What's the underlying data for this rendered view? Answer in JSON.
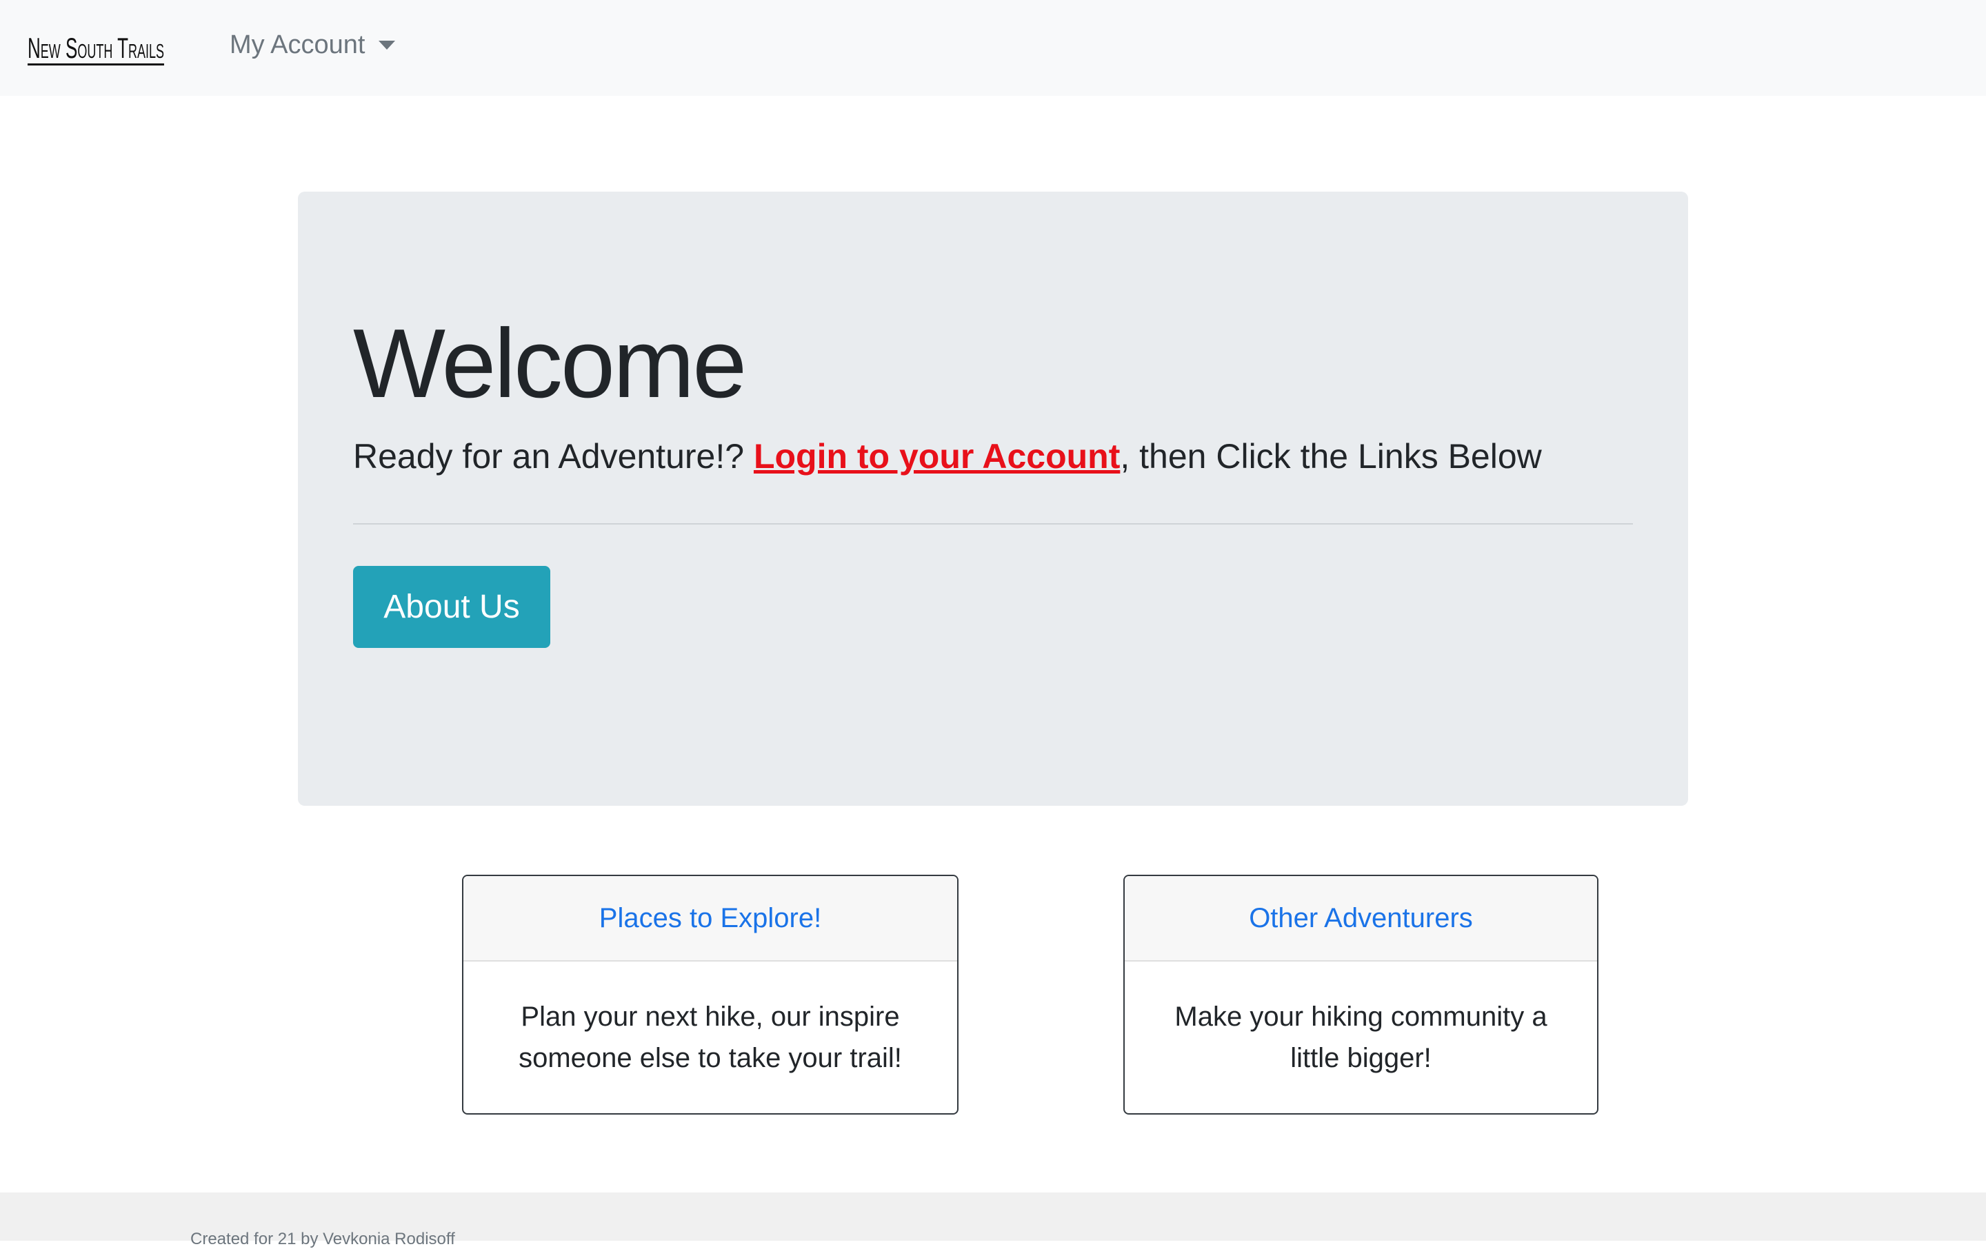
{
  "navbar": {
    "brand": "New South Trails",
    "account_label": "My Account"
  },
  "jumbotron": {
    "title": "Welcome",
    "lead_prefix": "Ready for an Adventure!? ",
    "lead_link": "Login to your Account",
    "lead_suffix": ", then Click the Links Below",
    "button_label": "About Us"
  },
  "cards": [
    {
      "header": "Places to Explore!",
      "body": "Plan your next hike, our inspire someone else to take your trail!"
    },
    {
      "header": "Other Adventurers",
      "body": "Make your hiking community a little bigger!"
    }
  ],
  "footer": {
    "text": "Created for 21 by Vevkonia Rodisoff"
  },
  "colors": {
    "link_red": "#e8101a",
    "button_teal": "#23a2b8",
    "card_link_blue": "#1a73e8"
  }
}
